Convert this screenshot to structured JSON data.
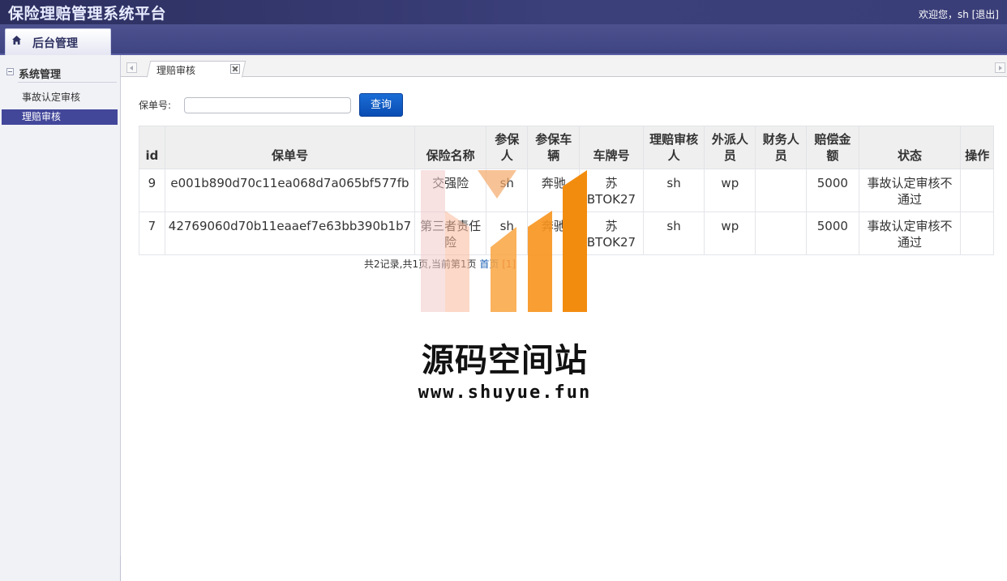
{
  "header": {
    "title": "保险理赔管理系统平台",
    "welcome": "欢迎您，sh",
    "logout": "[退出]"
  },
  "module_bar": {
    "active_module": "后台管理"
  },
  "sidebar": {
    "group_label": "系统管理",
    "items": [
      {
        "label": "事故认定审核",
        "active": false
      },
      {
        "label": "理赔审核",
        "active": true
      }
    ]
  },
  "tabs": {
    "items": [
      {
        "label": "理赔审核"
      }
    ]
  },
  "search": {
    "label": "保单号:",
    "value": "",
    "placeholder": "",
    "button_label": "查询"
  },
  "table": {
    "headers": [
      "id",
      "保单号",
      "保险名称",
      "参保人",
      "参保车辆",
      "车牌号",
      "理赔审核人",
      "外派人员",
      "财务人员",
      "赔偿金额",
      "状态",
      "操作"
    ],
    "rows": [
      [
        "9",
        "e001b890d70c11ea068d7a065bf577fb",
        "交强险",
        "sh",
        "奔驰",
        "苏BTOK27",
        "sh",
        "wp",
        "",
        "5000",
        "事故认定审核不通过",
        ""
      ],
      [
        "7",
        "42769060d70b11eaaef7e63bb390b1b7",
        "第三者责任险",
        "sh",
        "奔驰",
        "苏BTOK27",
        "sh",
        "wp",
        "",
        "5000",
        "事故认定审核不通过",
        ""
      ]
    ]
  },
  "pagination": {
    "summary": "共2记录,共1页,当前第1页",
    "first": "首页",
    "current_page": "[1]"
  },
  "watermark": {
    "name": "源码空间站",
    "url": "www.shuyue.fun"
  },
  "colors": {
    "header_bg": "#2c2f5e",
    "sidebar_active_bg": "#43479a",
    "primary_button": "#0a4db3",
    "watermark_orange": "#f7941d"
  }
}
